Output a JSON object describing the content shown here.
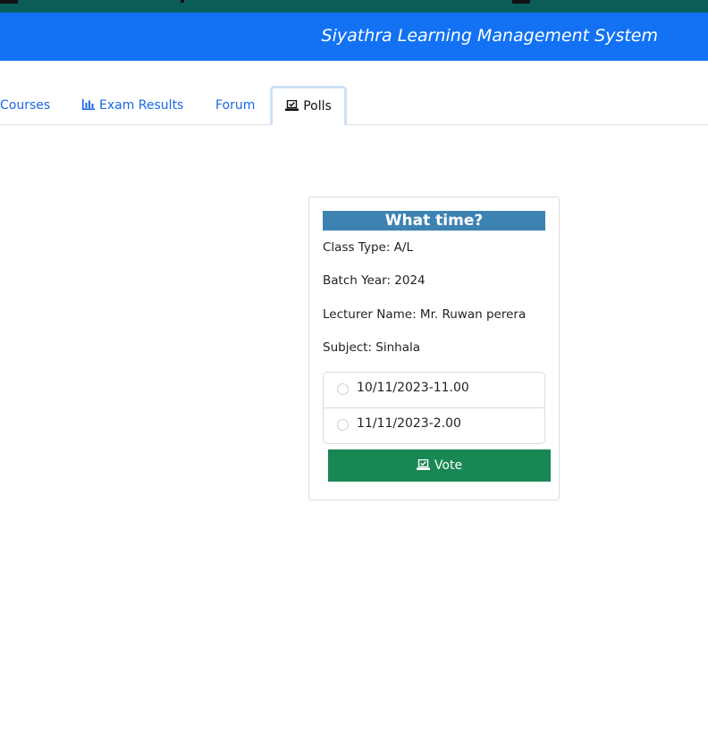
{
  "header": {
    "title": "Siyathra Learning Management System",
    "colors": {
      "topstrip": "#0b5d5a",
      "banner": "#1272f3"
    }
  },
  "tabs": [
    {
      "label": "Courses",
      "icon": ""
    },
    {
      "label": "Exam Results",
      "icon": "bar-chart-icon"
    },
    {
      "label": "Forum",
      "icon": ""
    },
    {
      "label": "Polls",
      "icon": "ballot-box-icon",
      "active": true
    }
  ],
  "poll": {
    "question": "What time?",
    "class_type": "Class Type: A/L",
    "batch_year": "Batch Year: 2024",
    "lecturer": "Lecturer Name: Mr. Ruwan perera",
    "subject": "Subject: Sinhala",
    "options": [
      {
        "label": "10/11/2023-11.00",
        "selected": false
      },
      {
        "label": "11/11/2023-2.00",
        "selected": false
      }
    ],
    "vote_label": "Vote",
    "colors": {
      "title_bg": "#3d83b2",
      "vote_bg": "#198754"
    }
  }
}
